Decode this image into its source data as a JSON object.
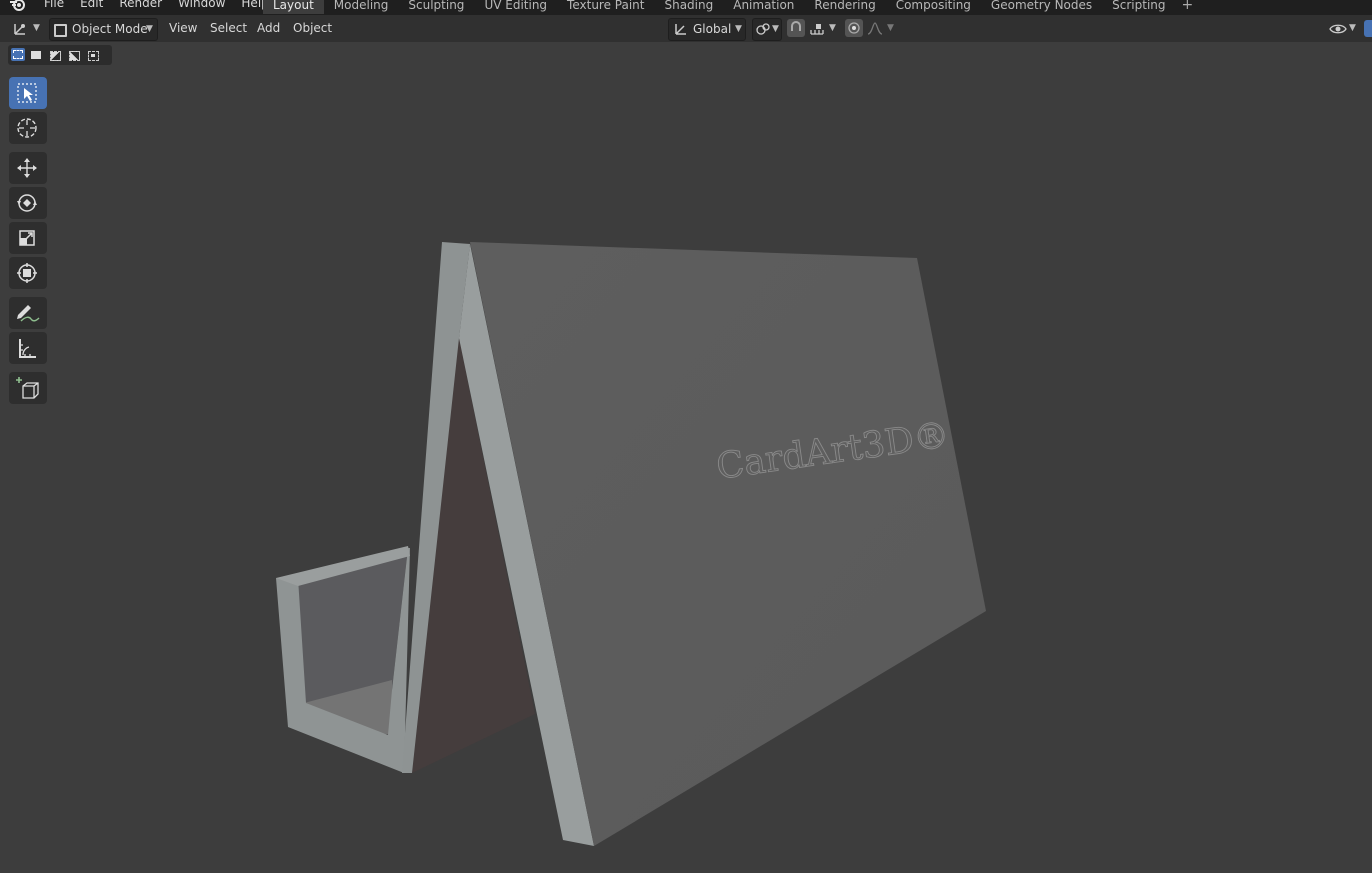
{
  "menu": {
    "items": [
      "File",
      "Edit",
      "Render",
      "Window",
      "Help"
    ]
  },
  "workspaces": {
    "tabs": [
      "Layout",
      "Modeling",
      "Sculpting",
      "UV Editing",
      "Texture Paint",
      "Shading",
      "Animation",
      "Rendering",
      "Compositing",
      "Geometry Nodes",
      "Scripting"
    ],
    "active": "Layout",
    "add_symbol": "+"
  },
  "header": {
    "mode": "Object Mode",
    "view": "View",
    "select": "Select",
    "add": "Add",
    "object": "Object",
    "orientation": "Global"
  },
  "toolbar": {
    "tools": [
      "select-box",
      "cursor",
      "move",
      "rotate",
      "scale",
      "transform",
      "annotate",
      "measure",
      "add-cube"
    ],
    "active": "select-box"
  },
  "scene": {
    "embossed_text": "CardArt3D®"
  },
  "colors": {
    "accent": "#4772b3",
    "background": "#3d3d3d",
    "topbar": "#1f1f1f",
    "header": "#303030"
  }
}
